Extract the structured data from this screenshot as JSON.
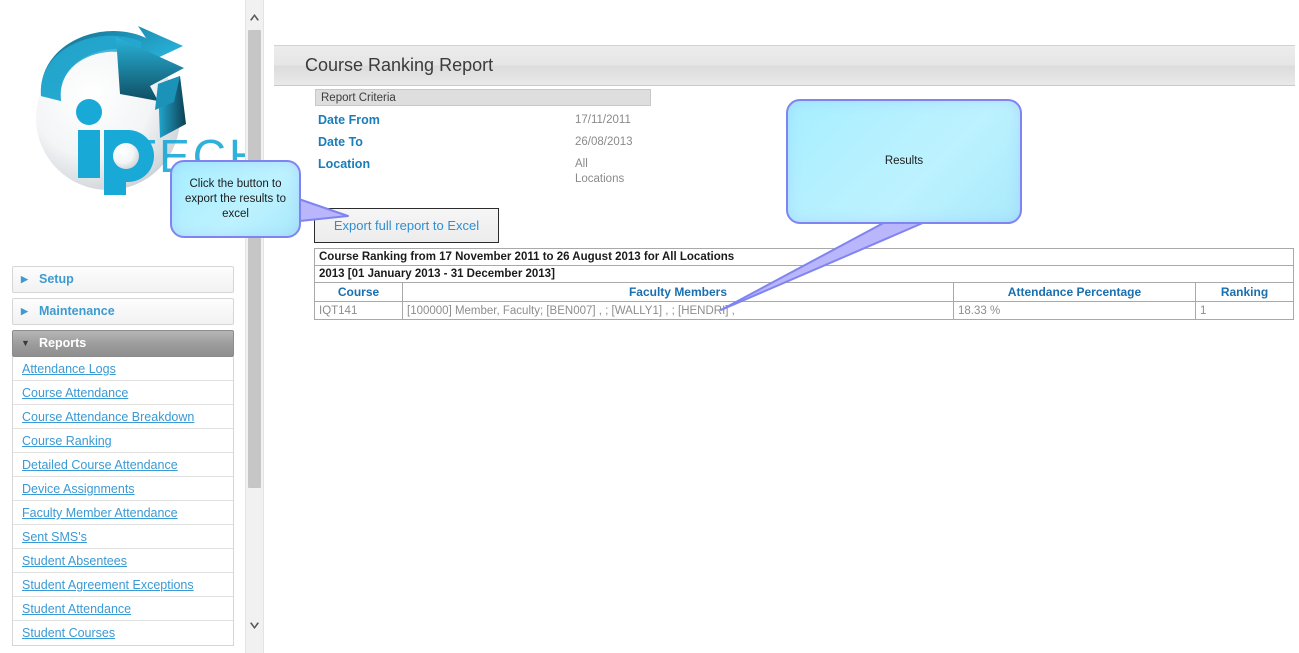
{
  "app": {
    "logo_text": "ipTECH",
    "logo_alt": "iptech-logo"
  },
  "scrollbar": {
    "up_icon": "chevron-up-icon",
    "down_icon": "chevron-down-icon",
    "thumb_name": "scrollbar-thumb"
  },
  "sidebar": {
    "sections": [
      {
        "label": "Setup",
        "expanded": false,
        "icon": "triangle-right-icon"
      },
      {
        "label": "Maintenance",
        "expanded": false,
        "icon": "triangle-right-icon"
      },
      {
        "label": "Reports",
        "expanded": true,
        "icon": "triangle-down-icon"
      }
    ],
    "report_links": [
      "Attendance Logs",
      "Course Attendance",
      "Course Attendance Breakdown",
      "Course Ranking",
      "Detailed Course Attendance",
      "Device Assignments",
      "Faculty Member Attendance",
      "Sent SMS's",
      "Student Absentees",
      "Student Agreement Exceptions",
      "Student Attendance",
      "Student Courses"
    ]
  },
  "header": {
    "title": "Course Ranking Report"
  },
  "criteria": {
    "heading": "Report Criteria",
    "rows": [
      {
        "label": "Date From",
        "value": "17/11/2011",
        "value2": ""
      },
      {
        "label": "Date To",
        "value": "26/08/2013",
        "value2": ""
      },
      {
        "label": "Location",
        "value": "All",
        "value2": "Locations"
      }
    ]
  },
  "toolbar": {
    "export_label": "Export full report to Excel"
  },
  "report": {
    "title_row": "Course Ranking from 17 November 2011 to 26 August 2013 for All Locations",
    "group_row": "2013 [01 January 2013 - 31 December 2013]",
    "columns": [
      "Course",
      "Faculty Members",
      "Attendance Percentage",
      "Ranking"
    ],
    "rows": [
      {
        "course": "IQT141",
        "faculty_members": "[100000] Member, Faculty; [BEN007] , ; [WALLY1] , ; [HENDRI] ,",
        "attendance_percentage": "18.33 %",
        "ranking": "1"
      }
    ]
  },
  "callouts": {
    "export": {
      "text": "Click the button to export the results to excel"
    },
    "results": {
      "text": "Results"
    }
  },
  "colors": {
    "link": "#3b9ad4",
    "header_label": "#1a7cba",
    "callout_fill": "#b5f0ff",
    "callout_border": "#8084f0",
    "active_section": "#9b9b9b"
  }
}
